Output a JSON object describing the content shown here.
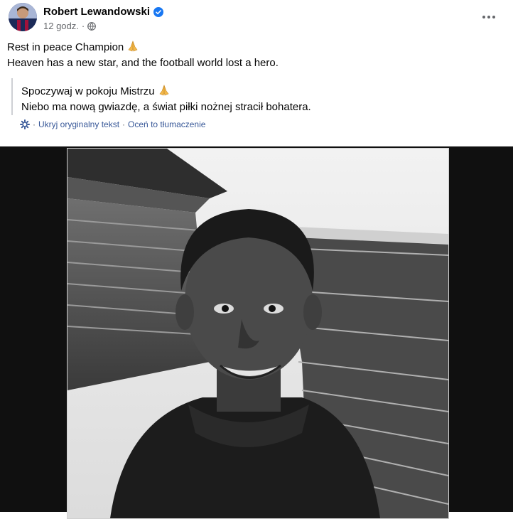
{
  "post": {
    "author": "Robert Lewandowski",
    "time": "12 godz.",
    "time_separator": "·",
    "text_line1": "Rest in peace Champion",
    "text_line2": "Heaven has a new star, and the football world lost a hero.",
    "translation_line1": "Spoczywaj w pokoju Mistrzu",
    "translation_line2": "Niebo ma nową gwiazdę, a świat piłki nożnej stracił bohatera.",
    "hide_original": "Ukryj oryginalny tekst",
    "rate_translation": "Oceń to tłumaczenie",
    "actions_separator": "·"
  },
  "icons": {
    "verified": "verified-badge-icon",
    "privacy": "globe-icon",
    "more": "more-options-icon",
    "translate": "gear-icon",
    "emoji": "praying-hands-emoji"
  },
  "colors": {
    "verified_blue": "#1877f2",
    "link_blue": "#385898",
    "meta_gray": "#65676b"
  }
}
